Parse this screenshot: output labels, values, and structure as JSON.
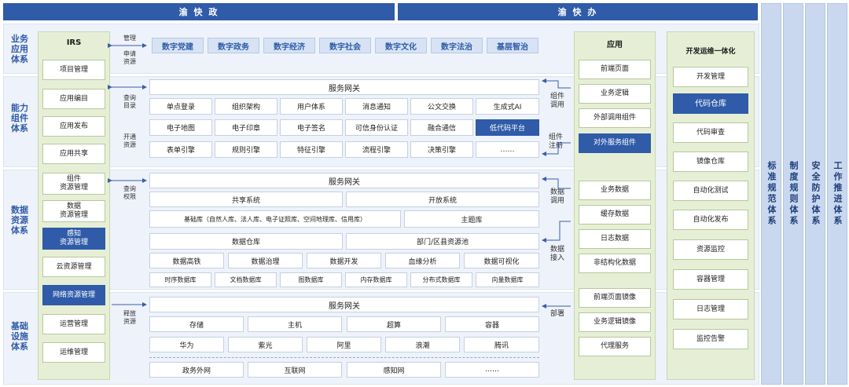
{
  "banners": {
    "left": "渝 快 政",
    "right": "渝 快 办"
  },
  "layers": [
    "业务\n应用\n体系",
    "能力\n组件\n体系",
    "数据\n资源\n体系",
    "基础\n设施\n体系"
  ],
  "irs": {
    "title": "IRS",
    "items": [
      "项目管理",
      "应用编目",
      "应用发布",
      "应用共享",
      "组件\n资源管理",
      "数据\n资源管理",
      "感知\n资源管理",
      "云资源管理",
      "网络资源管理",
      "运营管理",
      "运维管理"
    ]
  },
  "mid_labels": {
    "manage": "管理",
    "apply": "申请\n资源",
    "query_catalog": "查询\n目录",
    "open_resource": "开通\n资源",
    "query_permission": "查询\n权限",
    "release_resource": "释放\n资源"
  },
  "business_apps": [
    "数字党建",
    "数字政务",
    "数字经济",
    "数字社会",
    "数字文化",
    "数字法治",
    "基层智治"
  ],
  "gateway_label": "服务网关",
  "capability": {
    "rows": [
      [
        "单点登录",
        "组织架构",
        "用户体系",
        "消息通知",
        "公文交换",
        "生成式AI"
      ],
      [
        "电子地图",
        "电子印章",
        "电子签名",
        "可信身份认证",
        "融合通信",
        "低代码平台"
      ],
      [
        "表单引擎",
        "规则引擎",
        "特征引擎",
        "流程引擎",
        "决策引擎",
        "……"
      ]
    ]
  },
  "data_layer": {
    "shared": "共享系统",
    "open": "开放系统",
    "base_lib": "基础库（自然人库、法人库、电子证照库、空间地理库、信用库）",
    "theme_lib": "主题库",
    "warehouse": "数据仓库",
    "dept_pool": "部门/区县资源池",
    "tools": [
      "数据高铁",
      "数据治理",
      "数据开发",
      "血缘分析",
      "数据可视化"
    ],
    "dbs": [
      "时序数据库",
      "文档数据库",
      "图数据库",
      "内存数据库",
      "分布式数据库",
      "向量数据库"
    ]
  },
  "infra": {
    "row1": [
      "存储",
      "主机",
      "超算",
      "容器"
    ],
    "row2": [
      "华为",
      "紫光",
      "阿里",
      "浪潮",
      "腾讯"
    ],
    "row3": [
      "政务外网",
      "互联网",
      "感知网",
      "……"
    ]
  },
  "right_labels": {
    "component_call": "组件\n调用",
    "component_register": "组件\n注册",
    "data_call": "数据\n调用",
    "data_access": "数据\n接入",
    "deploy": "部署"
  },
  "apps_panel": {
    "title": "应用",
    "items": [
      "前端页面",
      "业务逻辑",
      "外部调用组件",
      "对外服务组件",
      "业务数据",
      "缓存数据",
      "日志数据",
      "非结构化数据",
      "前端页面镜像",
      "业务逻辑镜像",
      "代理服务"
    ]
  },
  "devops": {
    "title": "开发运维一体化",
    "items": [
      "开发管理",
      "代码仓库",
      "代码审查",
      "镜像仓库",
      "自动化测试",
      "自动化发布",
      "资源监控",
      "容器管理",
      "日志管理",
      "监控告警"
    ]
  },
  "systems": [
    "标准规范体系",
    "制度规则体系",
    "安全防护体系",
    "工作推进体系"
  ],
  "colors": {
    "primary": "#2f5ba8",
    "green_panel": "#e6efd6",
    "light_blue": "#eef2fa"
  }
}
